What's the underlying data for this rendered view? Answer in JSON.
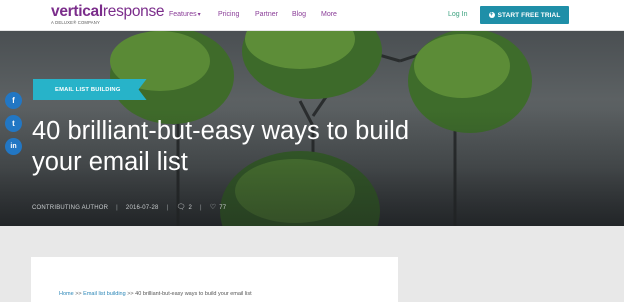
{
  "brand": {
    "logo_main_1": "vertical",
    "logo_main_2": "response",
    "logo_sub": "A DELUXE® COMPANY"
  },
  "nav": {
    "items": [
      {
        "label": "Features",
        "has_dropdown": true
      },
      {
        "label": "Pricing"
      },
      {
        "label": "Partner"
      },
      {
        "label": "Blog"
      },
      {
        "label": "More"
      }
    ],
    "login": "Log In",
    "cta": "START FREE TRIAL"
  },
  "hero": {
    "category": "EMAIL LIST BUILDING",
    "title_line1": "40 brilliant-but-easy ways to build",
    "title_line2": "your email list",
    "author": "CONTRIBUTING AUTHOR",
    "date": "2016-07-28",
    "comments": "2",
    "likes": "77"
  },
  "social": [
    {
      "icon": "facebook-icon",
      "glyph": "f"
    },
    {
      "icon": "twitter-icon",
      "glyph": "t"
    },
    {
      "icon": "linkedin-icon",
      "glyph": "in"
    }
  ],
  "breadcrumb": {
    "home": "Home",
    "separator": ">>",
    "category": "Email list building",
    "current": "40 brilliant-but-easy ways to build your email list"
  },
  "colors": {
    "brand_purple": "#7b2d8b",
    "cta_teal": "#1f8fa8",
    "category_teal": "#27b3c9",
    "login_green": "#3aa17e",
    "social_blue": "#2277c4"
  }
}
